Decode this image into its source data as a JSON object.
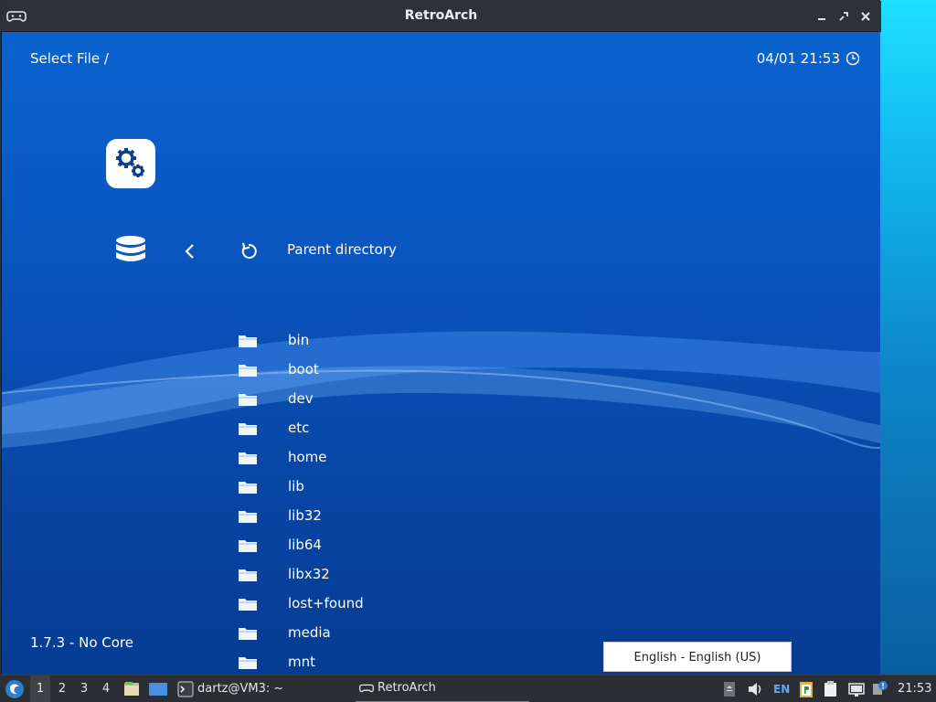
{
  "window": {
    "title": "RetroArch",
    "controls": [
      "minimize",
      "maximize",
      "close"
    ]
  },
  "header": {
    "path_label": "Select File /",
    "datetime": "04/01 21:53"
  },
  "navigation": {
    "parent_label": "Parent directory"
  },
  "files": [
    {
      "name": "bin"
    },
    {
      "name": "boot"
    },
    {
      "name": "dev"
    },
    {
      "name": "etc"
    },
    {
      "name": "home"
    },
    {
      "name": "lib"
    },
    {
      "name": "lib32"
    },
    {
      "name": "lib64"
    },
    {
      "name": "libx32"
    },
    {
      "name": "lost+found"
    },
    {
      "name": "media"
    },
    {
      "name": "mnt"
    }
  ],
  "footer": {
    "version": "1.7.3 - No Core"
  },
  "language_popup": {
    "text": "English - English (US)"
  },
  "taskbar": {
    "workspaces": [
      "1",
      "2",
      "3",
      "4"
    ],
    "active_workspace": "1",
    "terminal_task": "dartz@VM3: ~",
    "active_task": "RetroArch",
    "lang_indicator": "EN",
    "clock": "21:53"
  },
  "colors": {
    "menu_bg_top": "#0a63cf",
    "menu_bg_bottom": "#063c92",
    "titlebar": "#2e3238",
    "taskbar": "#2b2f34",
    "accent": "#3d8fd6"
  }
}
